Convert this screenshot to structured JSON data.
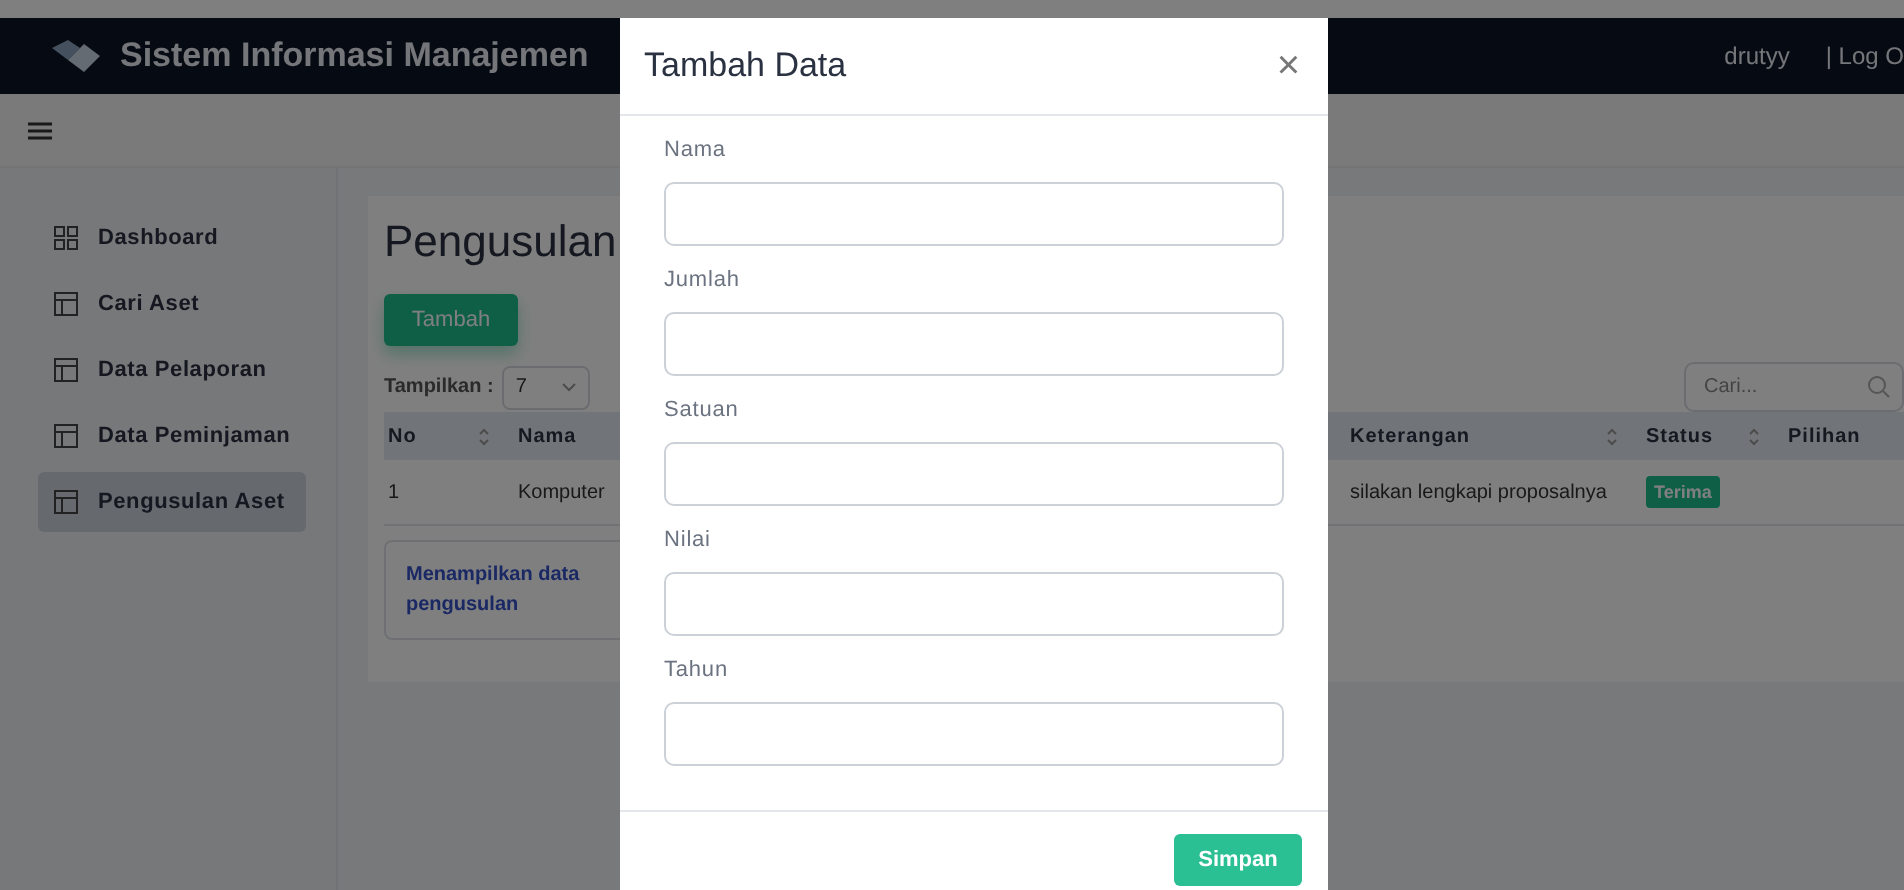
{
  "header": {
    "title": "Sistem Informasi Manajemen",
    "user": "drutyy",
    "logout": "| Log O"
  },
  "sidebar": {
    "items": [
      {
        "label": "Dashboard",
        "selected": false
      },
      {
        "label": "Cari Aset",
        "selected": false
      },
      {
        "label": "Data Pelaporan",
        "selected": false
      },
      {
        "label": "Data Peminjaman",
        "selected": false
      },
      {
        "label": "Pengusulan Aset",
        "selected": true
      }
    ]
  },
  "content": {
    "title": "Pengusulan",
    "add_button": "Tambah",
    "show_label": "Tampilkan :",
    "page_size": "7",
    "search": {
      "placeholder": "Cari..."
    },
    "table": {
      "columns": [
        {
          "label": "No",
          "sortable": true
        },
        {
          "label": "Nama",
          "sortable": false
        },
        {
          "label": "Keterangan",
          "sortable": true
        },
        {
          "label": "Status",
          "sortable": true
        },
        {
          "label": "Pilihan",
          "sortable": false
        }
      ],
      "rows": [
        {
          "no": "1",
          "nama": "Komputer",
          "keterangan": "silakan lengkapi proposalnya",
          "status": "Terima"
        }
      ]
    },
    "info": [
      "Menampilkan data",
      "pengusulan"
    ]
  },
  "modal": {
    "title": "Tambah Data",
    "close": "×",
    "fields": [
      {
        "label": "Nama"
      },
      {
        "label": "Jumlah"
      },
      {
        "label": "Satuan"
      },
      {
        "label": "Nilai"
      },
      {
        "label": "Tahun"
      }
    ],
    "submit": "Simpan"
  }
}
